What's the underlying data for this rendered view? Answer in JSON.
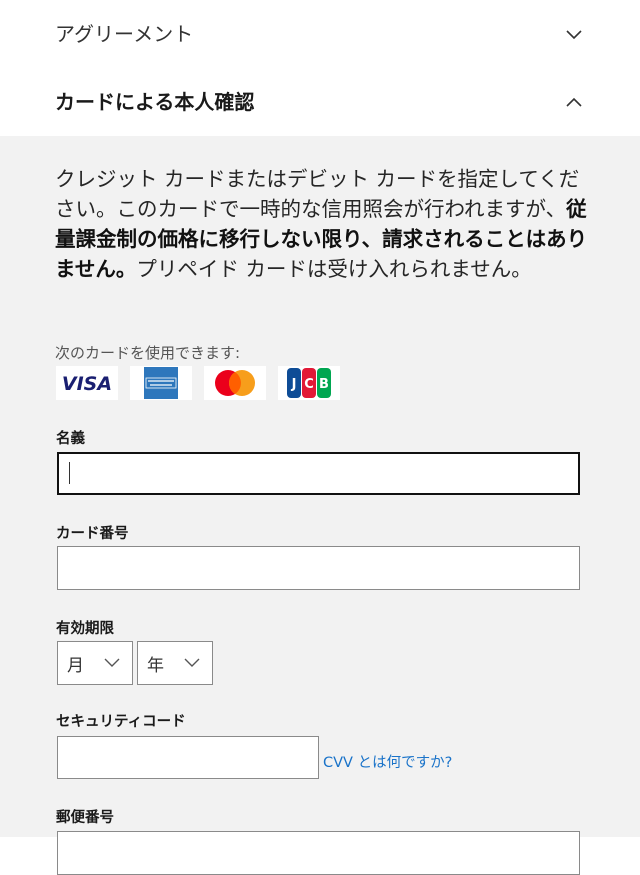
{
  "accordion": {
    "agreement": {
      "title": "アグリーメント",
      "state_icon": "chevron-down-icon"
    },
    "card_verification": {
      "title": "カードによる本人確認",
      "state_icon": "chevron-up-icon"
    }
  },
  "description": {
    "part1": "クレジット カードまたはデビット カードを指定してください。このカードで一時的な信用照会が行われますが、",
    "bold": "従量課金制の価格に移行しない限り、請求されることはありません。",
    "part2": "プリペイド カードは受け入れられません。"
  },
  "accepted_cards": {
    "label": "次のカードを使用できます:",
    "brands": [
      "VISA",
      "AMERICAN EXPRESS",
      "Mastercard",
      "JCB"
    ]
  },
  "form": {
    "name_label": "名義",
    "card_number_label": "カード番号",
    "expiry_label": "有効期限",
    "month_value": "月",
    "year_value": "年",
    "security_code_label": "セキュリティコード",
    "cvv_link": "CVV とは何ですか?",
    "postal_label": "郵便番号"
  },
  "colors": {
    "panel_bg": "#f2f2f2",
    "link": "#1a73c9",
    "visa": "#1a1f71",
    "amex": "#2e77bc",
    "mc_red": "#eb001b",
    "mc_yellow": "#f79e1b"
  }
}
